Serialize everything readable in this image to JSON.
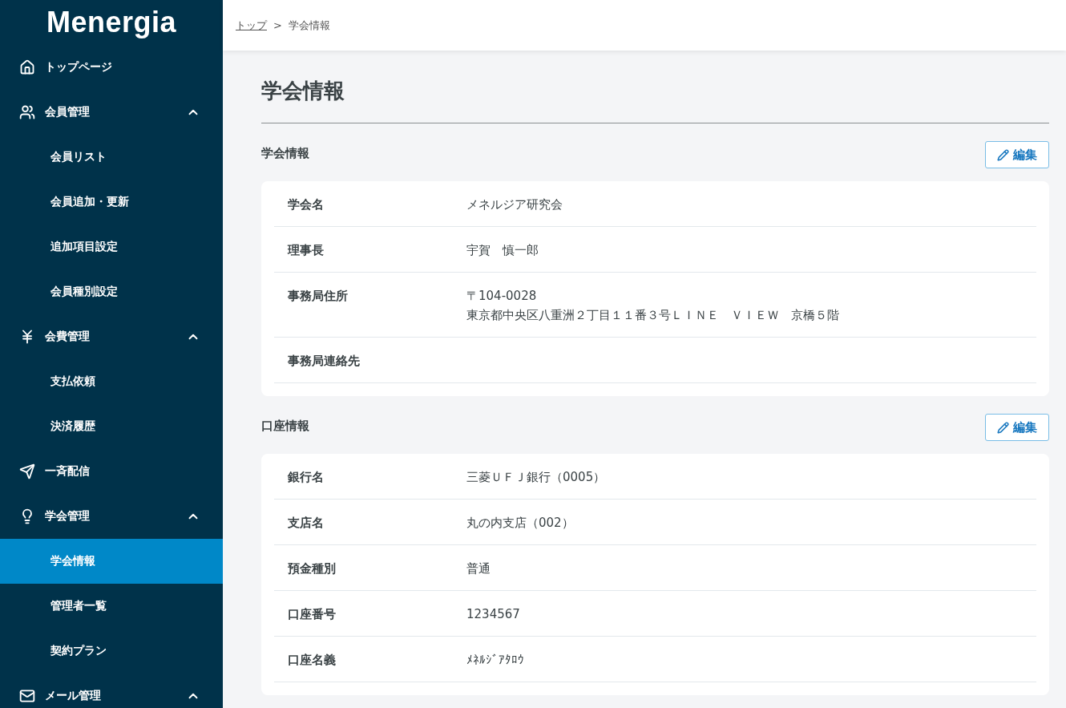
{
  "logo": "Menergia",
  "nav": [
    {
      "kind": "link",
      "label": "トップページ"
    },
    {
      "kind": "group",
      "label": "会員管理",
      "expanded": true,
      "children": [
        {
          "label": "会員リスト",
          "selected": false
        },
        {
          "label": "会員追加・更新",
          "selected": false
        },
        {
          "label": "追加項目設定",
          "selected": false
        },
        {
          "label": "会員種別設定",
          "selected": false
        }
      ]
    },
    {
      "kind": "group",
      "label": "会費管理",
      "expanded": true,
      "children": [
        {
          "label": "支払依頼",
          "selected": false
        },
        {
          "label": "決済履歴",
          "selected": false
        }
      ]
    },
    {
      "kind": "link",
      "label": "一斉配信"
    },
    {
      "kind": "group",
      "label": "学会管理",
      "expanded": true,
      "children": [
        {
          "label": "学会情報",
          "selected": true
        },
        {
          "label": "管理者一覧",
          "selected": false
        },
        {
          "label": "契約プラン",
          "selected": false
        }
      ]
    },
    {
      "kind": "group",
      "label": "メール管理",
      "expanded": true
    }
  ],
  "breadcrumb": {
    "link": "トップ",
    "separator": ">",
    "current": "学会情報"
  },
  "title": "学会情報",
  "sections": [
    {
      "title": "学会情報",
      "edit": "編集",
      "rows": [
        {
          "label": "学会名",
          "lines": [
            "メネルジア研究会"
          ]
        },
        {
          "label": "理事長",
          "lines": [
            "宇賀　慎一郎"
          ]
        },
        {
          "label": "事務局住所",
          "lines": [
            "〒104-0028",
            "東京都中央区八重洲２丁目１１番３号ＬＩＮＥ　ＶＩＥＷ　京橋５階"
          ]
        },
        {
          "label": "事務局連絡先"
        }
      ]
    },
    {
      "title": "口座情報",
      "edit": "編集",
      "rows": [
        {
          "label": "銀行名",
          "lines": [
            "三菱ＵＦＪ銀行（0005）"
          ]
        },
        {
          "label": "支店名",
          "lines": [
            "丸の内支店（002）"
          ]
        },
        {
          "label": "預金種別",
          "lines": [
            "普通"
          ]
        },
        {
          "label": "口座番号",
          "lines": [
            "1234567"
          ]
        },
        {
          "label": "口座名義",
          "lines": [
            "ﾒﾈﾙｼﾞｱﾀﾛｳ"
          ]
        }
      ]
    }
  ]
}
